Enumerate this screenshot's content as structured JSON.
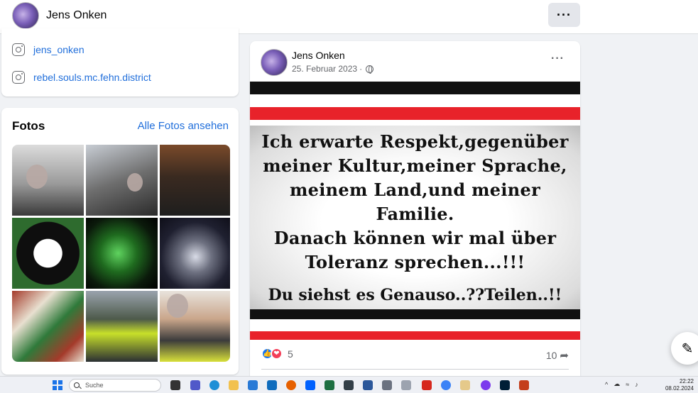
{
  "header": {
    "profile_name": "Jens Onken",
    "more_label": "···"
  },
  "intro": {
    "links": [
      {
        "label": "jens_onken",
        "icon": "instagram-icon"
      },
      {
        "label": "rebel.souls.mc.fehn.district",
        "icon": "instagram-icon"
      }
    ]
  },
  "photos": {
    "title": "Fotos",
    "see_all": "Alle Fotos ansehen",
    "count": 9
  },
  "post": {
    "author": "Jens Onken",
    "date": "25. Februar 2023",
    "separator": "·",
    "privacy_icon": "globe-icon",
    "more_label": "···",
    "image_text_lines": [
      "Ich erwarte Respekt,gegenüber",
      "meiner Kultur,meiner Sprache,",
      "meinem Land,und meiner",
      "Familie.",
      "Danach können wir mal über",
      "Toleranz sprechen...!!!"
    ],
    "image_text_last": "Du siehst es Genauso..??Teilen..!!",
    "reaction_count": "5",
    "share_count": "10",
    "colors": {
      "stripe_black": "#111111",
      "stripe_red": "#e8222a"
    }
  },
  "taskbar": {
    "search_placeholder": "Suche",
    "time": "22:22",
    "date": "08.02.2024"
  },
  "colors": {
    "link": "#216fdb",
    "page_bg": "#f0f2f5",
    "like": "#1877f2",
    "love": "#f33e58"
  }
}
